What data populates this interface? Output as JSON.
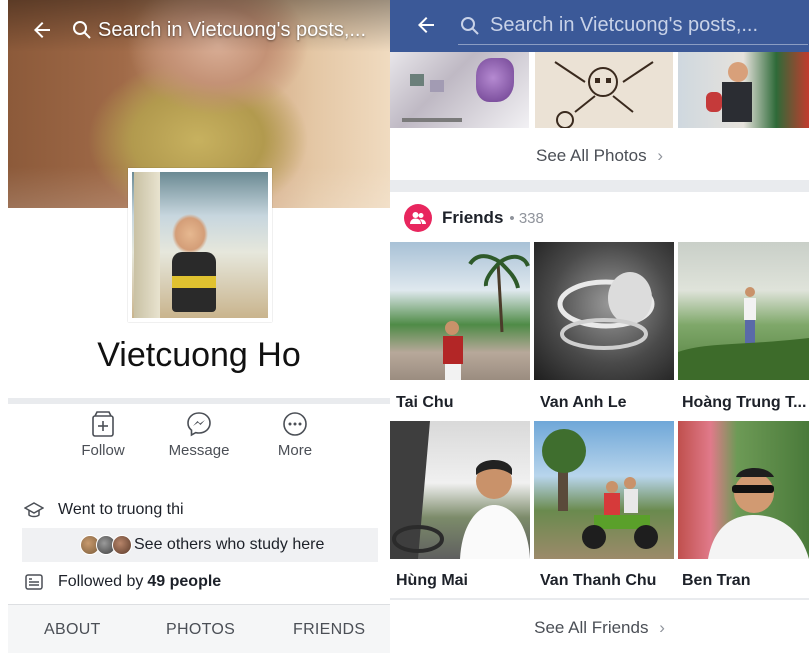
{
  "left": {
    "search_placeholder": "Search in Vietcuong's posts,...",
    "profile_name": "Vietcuong Ho",
    "actions": [
      {
        "label": "Follow",
        "icon": "follow-icon"
      },
      {
        "label": "Message",
        "icon": "messenger-icon"
      },
      {
        "label": "More",
        "icon": "more-icon"
      }
    ],
    "education": {
      "prefix": "Went to ",
      "school": "truong thi"
    },
    "study_link": "See others who study here",
    "followed": {
      "prefix": "Followed by ",
      "count": "49 people"
    },
    "tabs": [
      "ABOUT",
      "PHOTOS",
      "FRIENDS"
    ]
  },
  "right": {
    "search_placeholder": "Search in Vietcuong's posts,...",
    "see_all_photos": "See All Photos",
    "friends_title": "Friends",
    "friends_count": "338",
    "friends": [
      {
        "name": "Tai Chu"
      },
      {
        "name": "Van Anh Le"
      },
      {
        "name": "Hoàng Trung T..."
      },
      {
        "name": "Hùng Mai"
      },
      {
        "name": "Van Thanh Chu"
      },
      {
        "name": "Ben Tran"
      }
    ],
    "see_all_friends": "See All Friends",
    "chevron": "›"
  },
  "colors": {
    "facebook_blue": "#3b5998",
    "friends_badge": "#e8265e",
    "text_secondary": "#4b4f56",
    "divider": "#e9ebee"
  }
}
